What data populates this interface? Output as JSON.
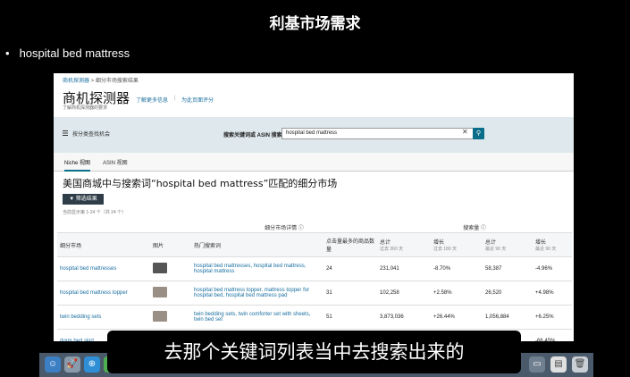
{
  "slide": {
    "title": "利基市场需求",
    "bullet": "hospital bed mattress",
    "subtitle": "去那个关键词列表当中去搜索出来的"
  },
  "app": {
    "breadcrumb_root": "商机探测器",
    "breadcrumb_sep": ">",
    "breadcrumb_current": "细分市场搜索结果",
    "brand": "商机探测器",
    "brand_sub": "了解商机探测器的要求",
    "learn_more": "了解更多信息",
    "separator": "|",
    "feedback": "为此页面评分",
    "filter_label": "按分类查找机会",
    "search_label": "搜索关键词或 ASIN 搜索",
    "search_value": "hospital bed mattress",
    "tabs": [
      {
        "label": "Niche 视图"
      },
      {
        "label": "ASIN 视图"
      }
    ],
    "heading": "美国商城中与搜索词“hospital bed mattress”匹配的细分市场",
    "filter_button": "筛选结果",
    "range_text": "当前显示第 1-24 个（共 24 个）"
  },
  "table": {
    "group_details": "细分市场详情 ⓘ",
    "group_search": "搜索量 ⓘ",
    "columns": {
      "niche": "细分市场",
      "image": "图片",
      "keywords": "热门搜索词",
      "products": "点击量最多的商品数量",
      "total360": "总计",
      "total360_sub": "过去 360 天",
      "growth180": "增长",
      "growth180_sub": "过去 180 天",
      "total90": "总计",
      "total90_sub": "最近 90 天",
      "growth90": "增长",
      "growth90_sub": "最近 90 天"
    },
    "rows": [
      {
        "niche": "hospital bed mattresses",
        "keywords": "hospital bed mattresses, hospital bed mattress, hospital mattress",
        "products": "24",
        "total360": "231,041",
        "growth180": "-8.70%",
        "total90": "58,387",
        "growth90": "-4.96%"
      },
      {
        "niche": "hospital bed mattress topper",
        "keywords": "hospital bed mattress topper, mattress topper for hospital bed, hospital bed mattress pad",
        "products": "31",
        "total360": "102,258",
        "growth180": "+2.58%",
        "total90": "26,520",
        "growth90": "+4.98%"
      },
      {
        "niche": "twin bedding sets",
        "keywords": "twin bedding sets, twin comforter set with sheets, twin bed set",
        "products": "51",
        "total360": "3,873,036",
        "growth180": "+26.44%",
        "total90": "1,056,884",
        "growth90": "+6.25%"
      },
      {
        "niche": "dorm bed skirt",
        "keywords": "",
        "products": "",
        "total360": "",
        "growth180": "",
        "total90": "",
        "growth90": "-66.45%"
      }
    ]
  },
  "colors": {
    "accent": "#0a6e8a",
    "link": "#1a6fa0",
    "search_band": "#dfe9ed"
  }
}
